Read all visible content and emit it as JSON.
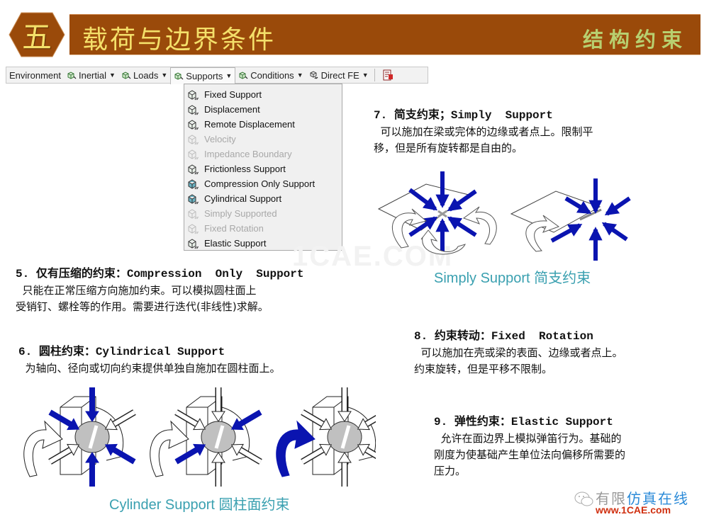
{
  "header": {
    "section_numeral": "五",
    "title": "载荷与边界条件",
    "subtitle": "结构约束",
    "colors": {
      "banner": "#9a4a0a",
      "title_text": "#f4e06a",
      "subtitle_text": "#b8d070"
    }
  },
  "toolbar": {
    "items": [
      {
        "label": "Environment",
        "icon": null,
        "has_caret": false
      },
      {
        "label": "Inertial",
        "icon": "cube-icon",
        "has_caret": true
      },
      {
        "label": "Loads",
        "icon": "cube-icon",
        "has_caret": true
      },
      {
        "label": "Supports",
        "icon": "cube-icon",
        "has_caret": true,
        "active": true
      },
      {
        "label": "Conditions",
        "icon": "cube-icon",
        "has_caret": true
      },
      {
        "label": "Direct FE",
        "icon": "direct-fe-icon",
        "has_caret": true
      }
    ],
    "end_icon": "worksheet-icon",
    "caret": "▼"
  },
  "supports_menu": {
    "items": [
      {
        "label": "Fixed Support",
        "enabled": true,
        "icon": "fixed-support-icon"
      },
      {
        "label": "Displacement",
        "enabled": true,
        "icon": "displacement-icon"
      },
      {
        "label": "Remote Displacement",
        "enabled": true,
        "icon": "remote-displacement-icon"
      },
      {
        "label": "Velocity",
        "enabled": false,
        "icon": "velocity-icon"
      },
      {
        "label": "Impedance Boundary",
        "enabled": false,
        "icon": "impedance-boundary-icon"
      },
      {
        "label": "Frictionless Support",
        "enabled": true,
        "icon": "frictionless-support-icon"
      },
      {
        "label": "Compression Only Support",
        "enabled": true,
        "icon": "compression-only-support-icon"
      },
      {
        "label": "Cylindrical Support",
        "enabled": true,
        "icon": "cylindrical-support-icon"
      },
      {
        "label": "Simply Supported",
        "enabled": false,
        "icon": "simply-supported-icon"
      },
      {
        "label": "Fixed Rotation",
        "enabled": false,
        "icon": "fixed-rotation-icon"
      },
      {
        "label": "Elastic Support",
        "enabled": true,
        "icon": "elastic-support-icon"
      }
    ]
  },
  "sections": {
    "s5": {
      "num": "5. ",
      "cn": "仅有压缩的约束：",
      "en": "Compression  Only  Support",
      "body": "  只能在正常压缩方向施加约束。可以模拟圆柱面上\n受销钉、螺栓等的作用。需要进行迭代(非线性)求解。"
    },
    "s6": {
      "num": "6. ",
      "cn": "圆柱约束：",
      "en": "Cylindrical Support",
      "body": "  为轴向、径向或切向约束提供单独自施加在圆柱面上。"
    },
    "s7": {
      "num": "7. ",
      "cn": "简支约束；",
      "en": "Simply  Support",
      "body": "  可以施加在梁或完体的边缘或者点上。限制平\n移，但是所有旋转都是自由的。"
    },
    "s8": {
      "num": "8. ",
      "cn": "约束转动：",
      "en": "Fixed  Rotation",
      "body": "  可以施加在壳或梁的表面、边缘或者点上。\n约束旋转，但是平移不限制。"
    },
    "s9": {
      "num": "9. ",
      "cn": "弹性约束：",
      "en": "Elastic Support",
      "body": "  允许在面边界上模拟弹笛行为。基础的\n刚度为使基础产生单位法向偏移所需要的\n压力。"
    }
  },
  "figures": {
    "simply_support_caption": "Simply Support 简支约束",
    "cylinder_support_caption": "Cylinder Support 圆柱面约束",
    "arrow_color": "#0a14b0",
    "caption_color": "#3aa0b0"
  },
  "watermark": "1CAE.COM",
  "branding": {
    "cn_gray": "有限",
    "cn_blue": "仿真在线",
    "url": "www.1CAE.com"
  }
}
